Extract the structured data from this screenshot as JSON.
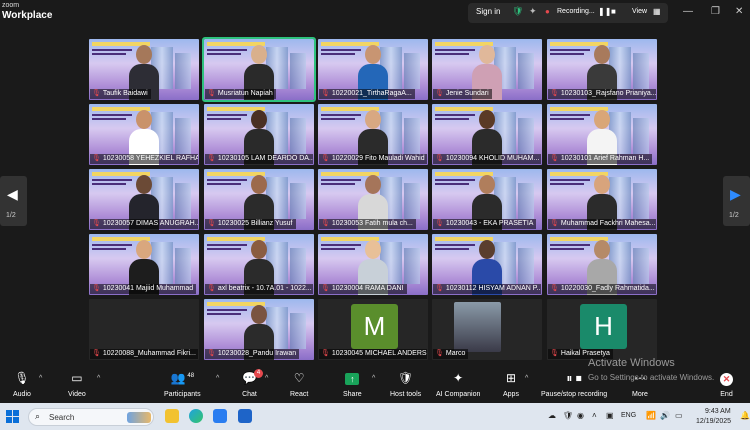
{
  "app": {
    "brand_small": "zoom",
    "title": "Workplace"
  },
  "topbar": {
    "signin": "Sign in",
    "recording": "Recording...",
    "view": "View"
  },
  "pager": {
    "left": "1/2",
    "right": "1/2"
  },
  "tiles": [
    {
      "name": "Taufik Baidawi",
      "type": "slide",
      "skin": "#a5785a",
      "shirt": "#2d2d35"
    },
    {
      "name": "Musriatun Napiah",
      "type": "slide",
      "skin": "#d9b08c",
      "shirt": "#2a2a2a",
      "active": true
    },
    {
      "name": "10220021_TirthaRagaA...",
      "type": "slide",
      "skin": "#c89572",
      "shirt": "#2467b8"
    },
    {
      "name": "Jenie Sundari",
      "type": "slide",
      "skin": "#e0b89a",
      "shirt": "#cfa0b4"
    },
    {
      "name": "10230103_Rajsfano Prianiya...",
      "type": "slide",
      "skin": "#a87a5c",
      "shirt": "#3a3a3a"
    },
    {
      "name": "10230058 YEHEZKIEL RAFHA...",
      "type": "slide",
      "skin": "#c9926b",
      "shirt": "#ffffff"
    },
    {
      "name": "10230105 LAM DEARDO DA...",
      "type": "slide",
      "skin": "#4a3024",
      "shirt": "#2a2a2a"
    },
    {
      "name": "10220029 Fito Mauladi Wahid",
      "type": "slide",
      "skin": "#d8a882",
      "shirt": "#2b2b2b"
    },
    {
      "name": "10230094 KHOLID MUHAM...",
      "type": "slide",
      "skin": "#5a3a26",
      "shirt": "#2b2b2b"
    },
    {
      "name": "10230101 Arief Rahman H...",
      "type": "slide",
      "skin": "#d9a678",
      "shirt": "#f4f4f4"
    },
    {
      "name": "10230057 DIMAS ANUGRAH...",
      "type": "slide",
      "skin": "#6b4a36",
      "shirt": "#24242c"
    },
    {
      "name": "10230025 Billianz Yusuf",
      "type": "slide",
      "skin": "#9c6a4c",
      "shirt": "#2b2b2b"
    },
    {
      "name": "10230053 Fatih mula ch...",
      "type": "slide",
      "skin": "#a5755a",
      "shirt": "#d8d8d8"
    },
    {
      "name": "10230043 - EKA PRASETIA",
      "type": "slide",
      "skin": "#b07e5c",
      "shirt": "#2b2b2b"
    },
    {
      "name": "Muhammad Fackhri Mahesa...",
      "type": "slide",
      "skin": "#d8a47c",
      "shirt": "#2b2b2b"
    },
    {
      "name": "10230041 Majiid Muhammad",
      "type": "slide",
      "skin": "#d9a77e",
      "shirt": "#1d1d1d"
    },
    {
      "name": "axl beatrix - 10.7A.01 - 1022...",
      "type": "slide",
      "skin": "#8a5c40",
      "shirt": "#2b2b2b"
    },
    {
      "name": "10230004 RAMA DANI",
      "type": "slide",
      "skin": "#e8c098",
      "shirt": "#c8d0d8"
    },
    {
      "name": "10230112 HISYAM ADNAN P...",
      "type": "slide",
      "skin": "#5a3e2e",
      "shirt": "#2a4aa8"
    },
    {
      "name": "10220030_Fadly Rahmatida...",
      "type": "slide",
      "skin": "#b58a68",
      "shirt": "#a8a8a8"
    },
    {
      "name": "10220088_Muhammad Fikri...",
      "type": "dark"
    },
    {
      "name": "10230028_Pandu Irawan",
      "type": "slide",
      "skin": "#7a5440",
      "shirt": "#2b2b2b"
    },
    {
      "name": "10230045 MICHAEL ANDERS...",
      "type": "avatar",
      "letter": "M",
      "color": "#5a8e2c"
    },
    {
      "name": "Marco",
      "type": "photo"
    },
    {
      "name": "Haikal Prasetya",
      "type": "avatar",
      "letter": "H",
      "color": "#1a8a6a"
    }
  ],
  "toolbar": {
    "audio": "Audio",
    "video": "Video",
    "participants": "Participants",
    "participants_count": "48",
    "chat": "Chat",
    "chat_badge": "4",
    "react": "React",
    "share": "Share",
    "host_tools": "Host tools",
    "ai_companion": "AI Companion",
    "apps": "Apps",
    "pause_stop": "Pause/stop recording",
    "more": "More",
    "end": "End"
  },
  "watermark": {
    "line1": "Activate Windows",
    "line2": "Go to Settings to activate Windows."
  },
  "taskbar": {
    "search_placeholder": "Search",
    "lang": "ENG",
    "time": "9:43 AM",
    "date": "12/19/2025"
  },
  "colors": {
    "accent_green": "#2ec27e",
    "record_red": "#e5484d",
    "share_green": "#19a35a"
  }
}
